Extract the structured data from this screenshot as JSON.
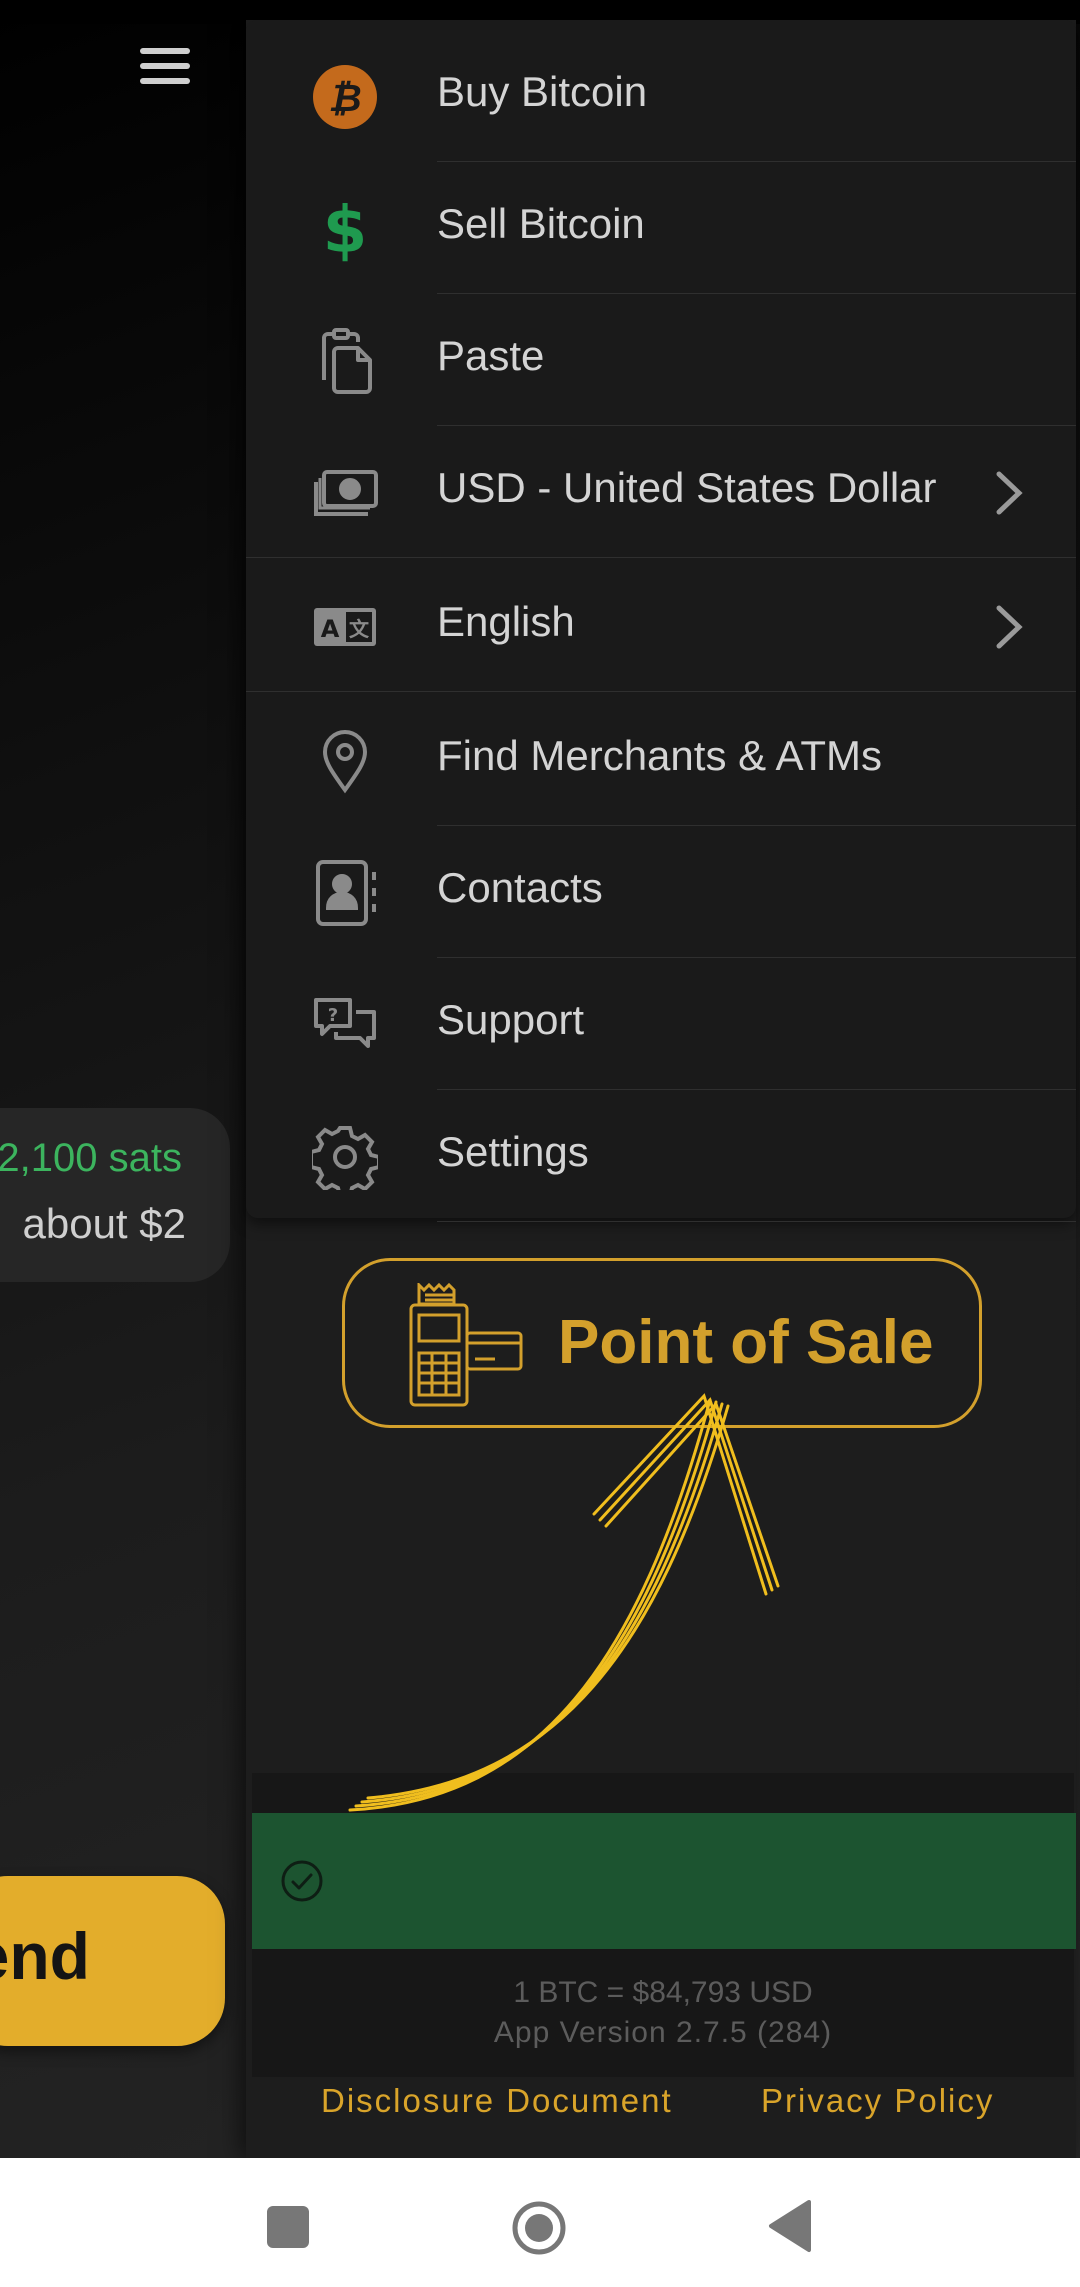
{
  "main": {
    "balance_sats": "2,100 sats",
    "balance_usd": "about $2",
    "send_label": "end"
  },
  "drawer": {
    "items": [
      {
        "label": "Buy Bitcoin",
        "icon": "bitcoin-icon",
        "has_chevron": false
      },
      {
        "label": "Sell Bitcoin",
        "icon": "dollar-icon",
        "has_chevron": false
      },
      {
        "label": "Paste",
        "icon": "clipboard-icon",
        "has_chevron": false
      },
      {
        "label": "USD - United States Dollar",
        "icon": "cash-icon",
        "has_chevron": true
      },
      {
        "label": "English",
        "icon": "translate-icon",
        "has_chevron": true
      },
      {
        "label": "Find Merchants & ATMs",
        "icon": "location-pin-icon",
        "has_chevron": false
      },
      {
        "label": "Contacts",
        "icon": "contacts-icon",
        "has_chevron": false
      },
      {
        "label": "Support",
        "icon": "support-chat-icon",
        "has_chevron": false
      },
      {
        "label": "Settings",
        "icon": "gear-icon",
        "has_chevron": false
      }
    ],
    "pos_button_label": "Point of Sale",
    "exchange_rate": "1 BTC = $84,793 USD",
    "app_version": "App Version 2.7.5 (284)",
    "disclosure_link": "Disclosure Document",
    "privacy_link": "Privacy Policy"
  },
  "colors": {
    "accent": "#e3ad2b",
    "pos_gold": "#d3a02c",
    "bitcoin_orange": "#c46a1c",
    "dollar_green": "#1f9a4f",
    "toast_green": "#1c5430",
    "balance_green": "#3cb45e"
  }
}
